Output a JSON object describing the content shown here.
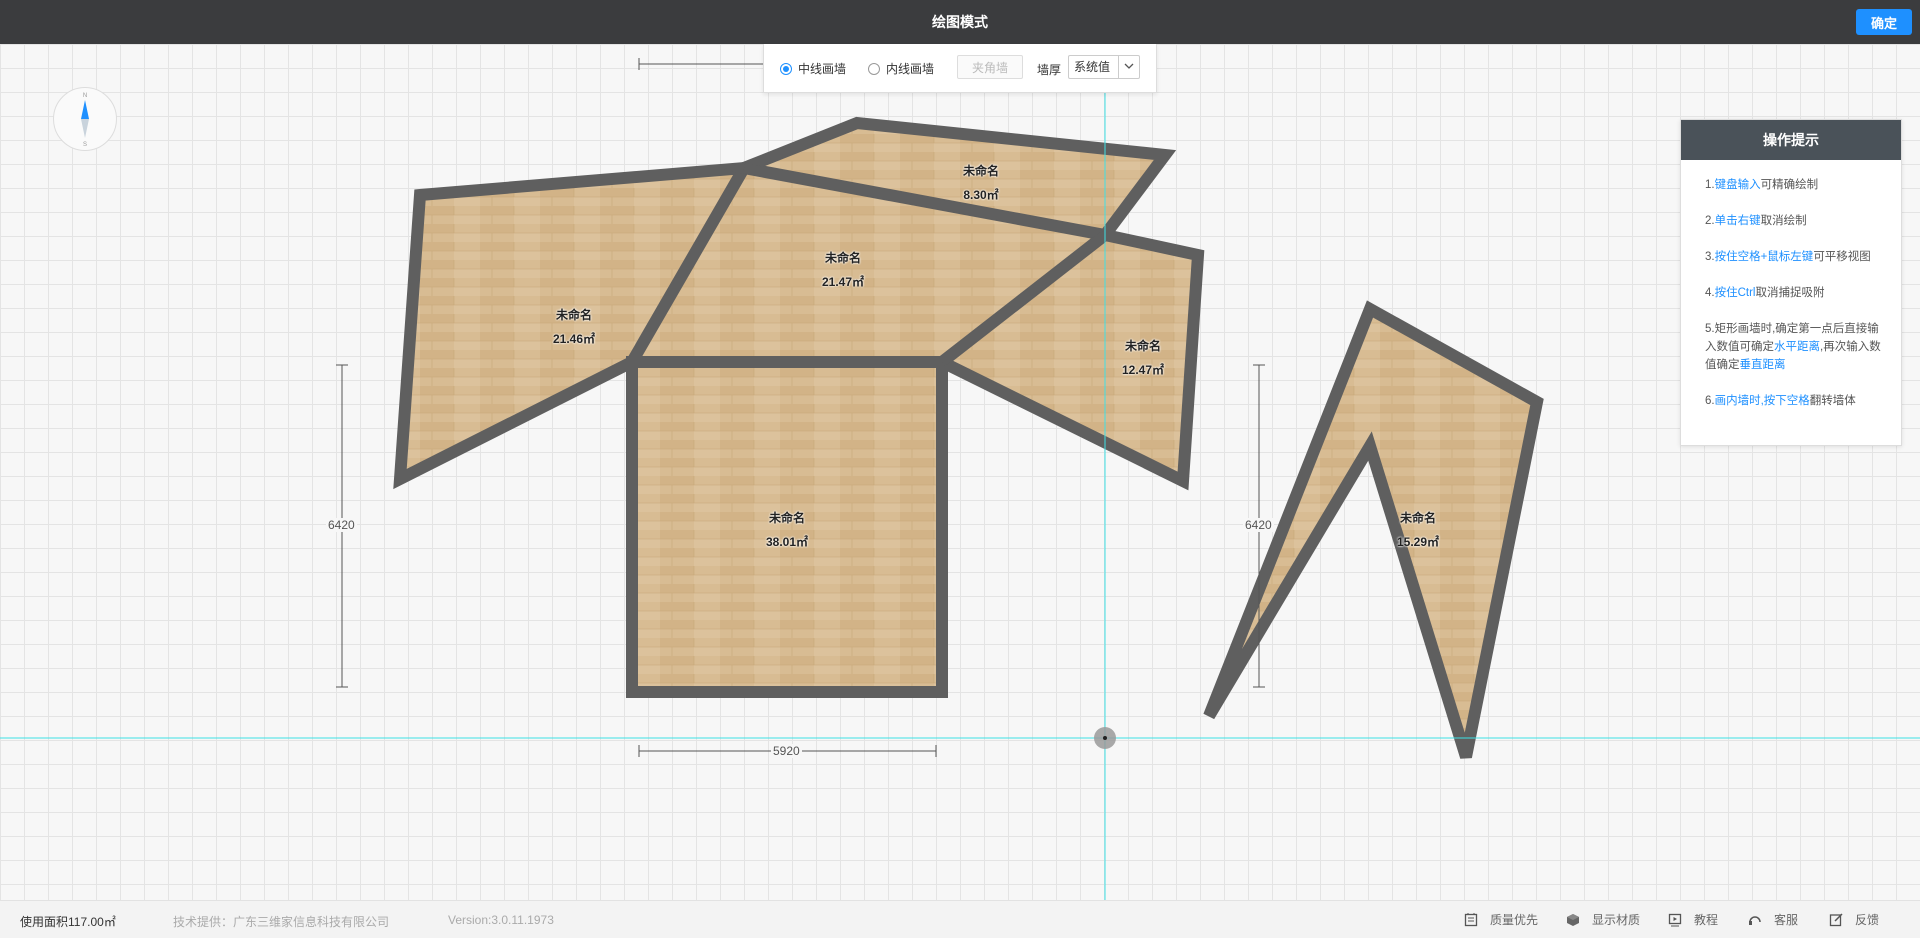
{
  "header": {
    "title": "绘图模式",
    "confirm_label": "确定"
  },
  "toolbar": {
    "center_wall_label": "中线画墙",
    "inner_wall_label": "内线画墙",
    "corner_wall_label": "夹角墙",
    "thickness_label": "墙厚",
    "thickness_value": "系统值",
    "selected_mode": "center"
  },
  "compass": {
    "north": "N",
    "south": "S",
    "icon": "compass-icon"
  },
  "rooms": [
    {
      "name": "未命名",
      "area": "21.46㎡"
    },
    {
      "name": "未命名",
      "area": "8.30㎡"
    },
    {
      "name": "未命名",
      "area": "21.47㎡"
    },
    {
      "name": "未命名",
      "area": "12.47㎡"
    },
    {
      "name": "未命名",
      "area": "38.01㎡"
    },
    {
      "name": "未命名",
      "area": "15.29㎡"
    }
  ],
  "dimensions": {
    "left_height": "6420",
    "right_height": "6420",
    "bottom_width": "5920"
  },
  "hints": {
    "title": "操作提示",
    "items": [
      {
        "prefix": "1.",
        "blue": "键盘输入",
        "rest": "可精确绘制"
      },
      {
        "prefix": "2.",
        "blue": "单击右键",
        "rest": "取消绘制"
      },
      {
        "prefix": "3.",
        "blue": "按住空格+鼠标左键",
        "rest": "可平移视图"
      },
      {
        "prefix": "4.",
        "blue": "按住Ctrl",
        "rest": "取消捕捉吸附"
      },
      {
        "prefix": "5.矩形画墙时,确定第一点后直接输入数值可确定",
        "blue": "水平距离",
        "mid": ",再次输入数值确定",
        "blue2": "垂直距离"
      },
      {
        "prefix": "6.",
        "blue": "画内墙时,按下空格",
        "rest": "翻转墙体"
      }
    ]
  },
  "status": {
    "usage_area": "使用面积117.00㎡",
    "provider": "技术提供：广东三维家信息科技有限公司",
    "version": "Version:3.0.11.1973"
  },
  "status_buttons": [
    {
      "label": "质量优先",
      "icon": "quality-icon"
    },
    {
      "label": "显示材质",
      "icon": "material-cube-icon"
    },
    {
      "label": "教程",
      "icon": "tutorial-play-icon"
    },
    {
      "label": "客服",
      "icon": "headset-icon"
    },
    {
      "label": "反馈",
      "icon": "feedback-edit-icon"
    }
  ],
  "colors": {
    "accent": "#1e90ff",
    "topbar": "#3b3c3e",
    "wall": "#5f5f5f",
    "floor": "#d6b88f",
    "guide": "#3ee0e6"
  }
}
